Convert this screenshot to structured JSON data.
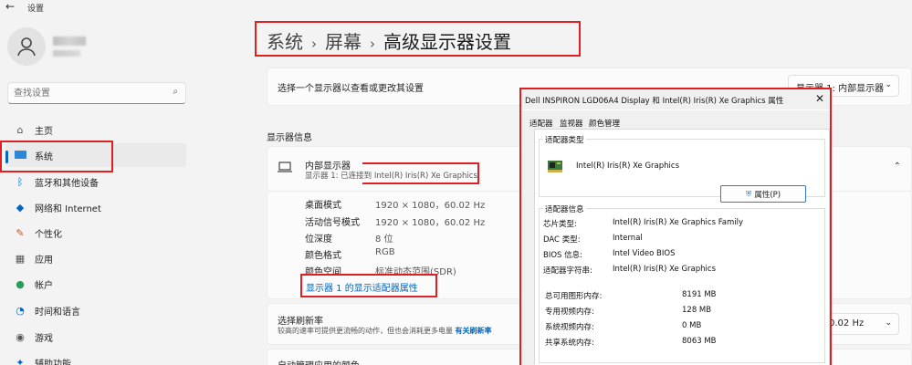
{
  "window": {
    "back_icon": "arrow-left-icon",
    "title": "设置"
  },
  "sidebar": {
    "search_placeholder": "查找设置",
    "items": [
      {
        "icon": "home-icon",
        "label": "主页"
      },
      {
        "icon": "system-icon",
        "label": "系统"
      },
      {
        "icon": "bluetooth-icon",
        "label": "蓝牙和其他设备"
      },
      {
        "icon": "network-icon",
        "label": "网络和 Internet"
      },
      {
        "icon": "personalization-icon",
        "label": "个性化"
      },
      {
        "icon": "apps-icon",
        "label": "应用"
      },
      {
        "icon": "accounts-icon",
        "label": "帐户"
      },
      {
        "icon": "time-language-icon",
        "label": "时间和语言"
      },
      {
        "icon": "gaming-icon",
        "label": "游戏"
      },
      {
        "icon": "accessibility-icon",
        "label": "辅助功能"
      }
    ],
    "active_index": 1
  },
  "breadcrumb": {
    "items": [
      "系统",
      "屏幕",
      "高级显示器设置"
    ],
    "separator": "›"
  },
  "main": {
    "select_display_label": "选择一个显示器以查看或更改其设置",
    "display_dropdown": "显示器 1: 内部显示器",
    "display_info_title": "显示器信息",
    "internal_display": {
      "name": "内部显示器",
      "subtitle": "显示器 1: 已连接到 Intel(R) Iris(R) Xe Graphics",
      "details": [
        {
          "label": "桌面模式",
          "value": "1920 × 1080，60.02 Hz"
        },
        {
          "label": "活动信号模式",
          "value": "1920 × 1080，60.02 Hz"
        },
        {
          "label": "位深度",
          "value": "8 位"
        },
        {
          "label": "颜色格式",
          "value": "RGB"
        },
        {
          "label": "颜色空间",
          "value": "标准动态范围(SDR)"
        }
      ],
      "adapter_link": "显示器 1 的显示适配器属性"
    },
    "refresh": {
      "title": "选择刷新率",
      "description": "较高的速率可提供更流畅的动作，但也会消耗更多电量",
      "more_link": "有关刷新率",
      "value": "0.02 Hz"
    },
    "next_row_title": "自动管理应用的颜色"
  },
  "dialog": {
    "title": "Dell INSPIRON LGD06A4 Display 和 Intel(R) Iris(R) Xe Graphics 属性",
    "tabs": [
      "适配器",
      "监视器",
      "颜色管理"
    ],
    "adapter_type_group": "适配器类型",
    "adapter_name": "Intel(R) Iris(R) Xe Graphics",
    "properties_button": "属性(P)",
    "adapter_info_group": "适配器信息",
    "info": [
      {
        "key": "芯片类型:",
        "value": "Intel(R) Iris(R) Xe Graphics Family"
      },
      {
        "key": "DAC 类型:",
        "value": "Internal"
      },
      {
        "key": "BIOS 信息:",
        "value": "Intel Video BIOS"
      },
      {
        "key": "适配器字符串:",
        "value": "Intel(R) Iris(R) Xe Graphics"
      }
    ],
    "memory": [
      {
        "key": "总可用图形内存:",
        "value": "8191 MB"
      },
      {
        "key": "专用视频内存:",
        "value": "128 MB"
      },
      {
        "key": "系统视频内存:",
        "value": "0 MB"
      },
      {
        "key": "共享系统内存:",
        "value": "8063 MB"
      }
    ]
  },
  "colors": {
    "accent": "#0067c0",
    "highlight": "#e02020"
  }
}
